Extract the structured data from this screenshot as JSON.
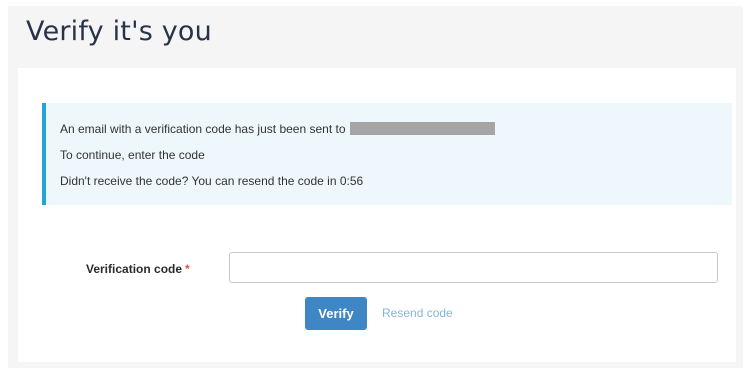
{
  "page": {
    "title": "Verify it's you"
  },
  "alert": {
    "line1": "An email with a verification code has just been sent to",
    "line2": "To continue, enter the code",
    "line3": "Didn't receive the code? You can resend the code in 0:56"
  },
  "form": {
    "code_label": "Verification code",
    "required_marker": "*",
    "code_value": "",
    "code_placeholder": ""
  },
  "actions": {
    "verify_label": "Verify",
    "resend_label": "Resend code"
  },
  "colors": {
    "title": "#27334a",
    "alert_background": "#eef7fb",
    "alert_border": "#28a3d8",
    "primary_button": "#3f87c4",
    "disabled_link": "#86b6dd",
    "required": "#d9534f"
  }
}
